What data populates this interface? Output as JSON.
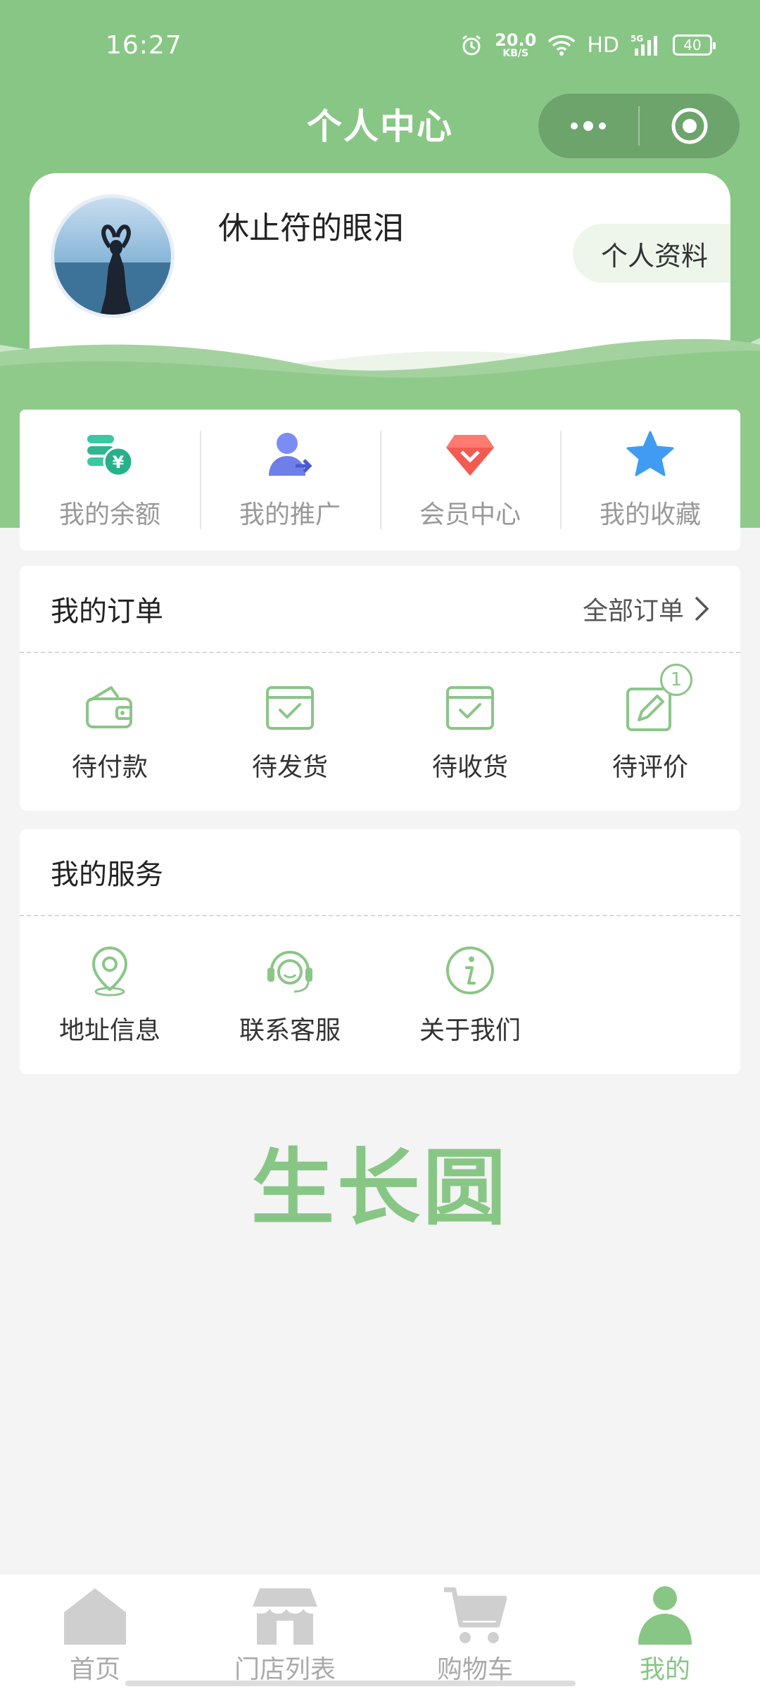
{
  "status_bar": {
    "time": "16:27",
    "net_speed_value": "20.0",
    "net_speed_unit": "KB/S",
    "hd": "HD",
    "network": "5G",
    "battery": "40"
  },
  "nav": {
    "title": "个人中心"
  },
  "profile": {
    "username": "休止符的眼泪",
    "profile_button": "个人资料"
  },
  "quick_entries": [
    {
      "label": "我的余额",
      "icon": "balance-coins-icon"
    },
    {
      "label": "我的推广",
      "icon": "promotion-user-icon"
    },
    {
      "label": "会员中心",
      "icon": "member-diamond-icon"
    },
    {
      "label": "我的收藏",
      "icon": "favorite-star-icon"
    }
  ],
  "orders": {
    "title": "我的订单",
    "all_orders": "全部订单",
    "items": [
      {
        "label": "待付款",
        "icon": "wallet-icon"
      },
      {
        "label": "待发货",
        "icon": "box-check-icon"
      },
      {
        "label": "待收货",
        "icon": "box-check-icon"
      },
      {
        "label": "待评价",
        "icon": "review-edit-icon",
        "badge": "1"
      }
    ]
  },
  "services": {
    "title": "我的服务",
    "items": [
      {
        "label": "地址信息",
        "icon": "location-pin-icon"
      },
      {
        "label": "联系客服",
        "icon": "customer-service-icon"
      },
      {
        "label": "关于我们",
        "icon": "info-icon"
      }
    ]
  },
  "brand": "生长圆",
  "tabbar": [
    {
      "label": "首页",
      "icon": "home-icon",
      "active": false
    },
    {
      "label": "门店列表",
      "icon": "store-icon",
      "active": false
    },
    {
      "label": "购物车",
      "icon": "cart-icon",
      "active": false
    },
    {
      "label": "我的",
      "icon": "user-icon",
      "active": true
    }
  ],
  "colors": {
    "primary_green": "#88c685",
    "light_green": "#eef6ec",
    "background": "#f4f4f4"
  }
}
